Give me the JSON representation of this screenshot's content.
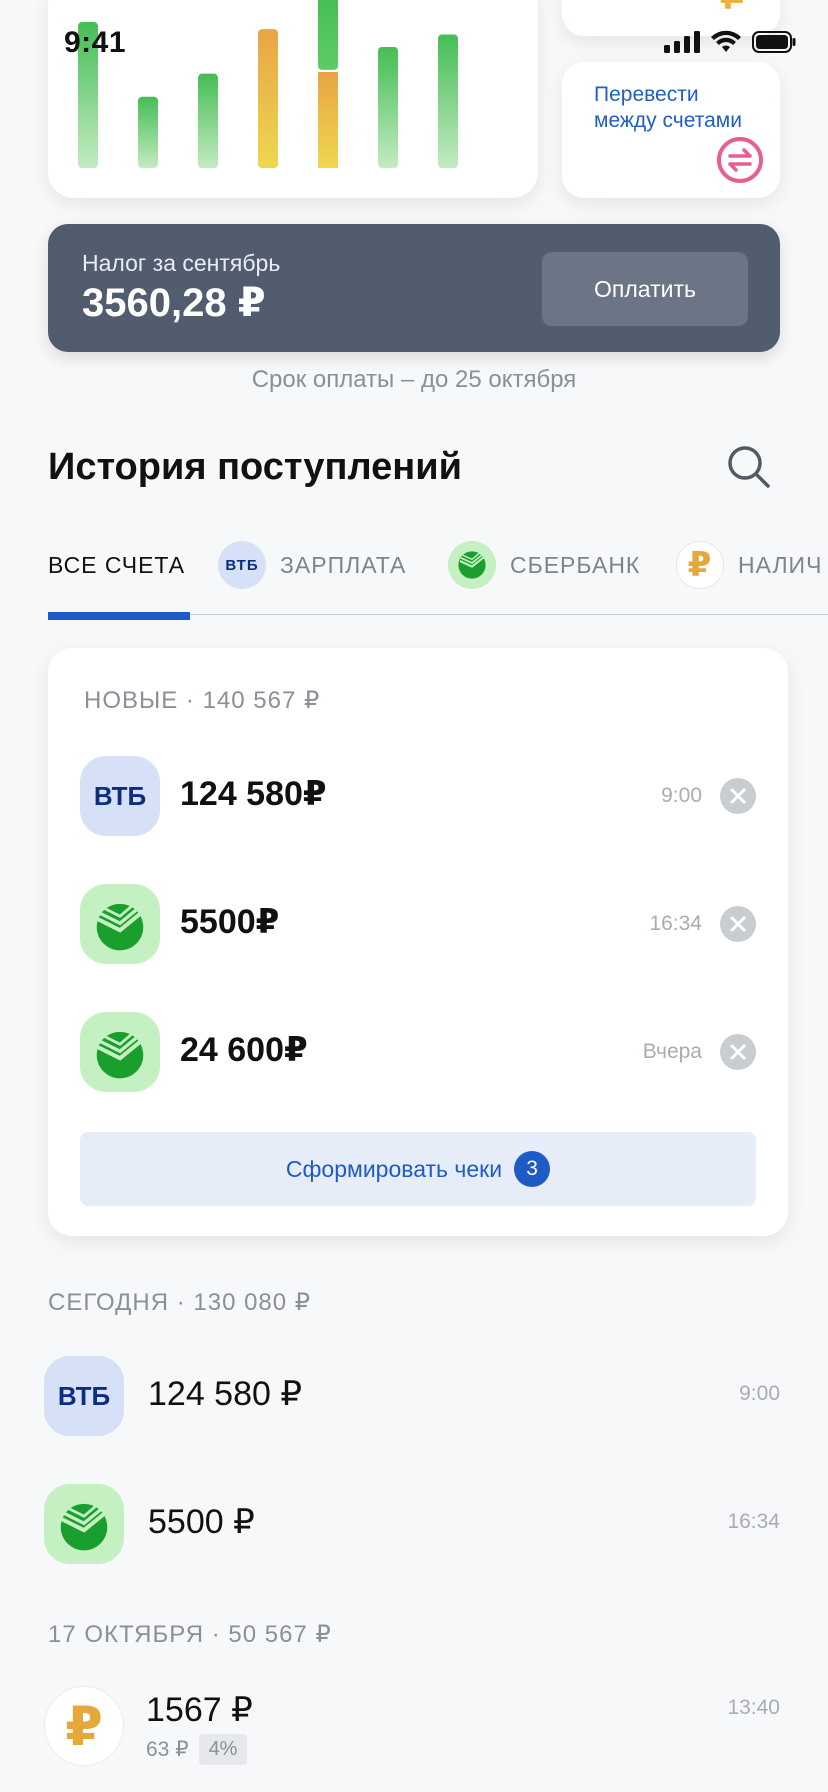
{
  "status_bar": {
    "time": "9:41"
  },
  "chart_card": {
    "bars": [
      {
        "total": 0.82,
        "split": null,
        "color": "green"
      },
      {
        "total": 0.4,
        "split": null,
        "color": "green"
      },
      {
        "total": 0.53,
        "split": null,
        "color": "green"
      },
      {
        "total": 0.78,
        "split": null,
        "color": "orange"
      },
      {
        "total": 1.0,
        "split": 0.54,
        "color": "mixed"
      },
      {
        "total": 0.68,
        "split": null,
        "color": "green"
      },
      {
        "total": 0.75,
        "split": null,
        "color": "green"
      }
    ]
  },
  "transfer_card": {
    "label": "Перевести между счетами"
  },
  "tax_card": {
    "label": "Налог за сентябрь",
    "amount": "3560,28 ₽",
    "pay_label": "Оплатить",
    "due_note": "Срок оплаты – до 25 октября"
  },
  "history": {
    "title": "История поступлений",
    "tabs": [
      {
        "label": "ВСЕ СЧЕТА",
        "badge": ""
      },
      {
        "label": "ЗАРПЛАТА",
        "badge": "ВТБ"
      },
      {
        "label": "СБЕРБАНК",
        "badge": ""
      },
      {
        "label": "НАЛИЧ",
        "badge": "₽"
      }
    ]
  },
  "new_group": {
    "header": "НОВЫЕ · 140 567 ₽",
    "rows": [
      {
        "bank": "ВТБ",
        "amount": "124 580₽",
        "time": "9:00"
      },
      {
        "bank": "",
        "amount": "5500₽",
        "time": "16:34"
      },
      {
        "bank": "",
        "amount": "24 600₽",
        "time": "Вчера"
      }
    ],
    "button_label": "Сформировать чеки",
    "button_count": "3"
  },
  "today_group": {
    "header": "СЕГОДНЯ · 130 080 ₽",
    "rows": [
      {
        "bank": "ВТБ",
        "amount": "124 580 ₽",
        "time": "9:00"
      },
      {
        "bank": "",
        "amount": "5500 ₽",
        "time": "16:34"
      }
    ]
  },
  "oct17_group": {
    "header": "17 ОКТЯБРЯ · 50 567 ₽",
    "rows": [
      {
        "bank": "₽",
        "amount": "1567 ₽",
        "time": "13:40",
        "sub_amount": "63 ₽",
        "sub_percent": "4%"
      }
    ]
  },
  "colors": {
    "accent": "#1e5bc6",
    "tax_card_bg": "#515c6e",
    "bar_green": "#4cc15a",
    "bar_orange": "#e7a846",
    "bar_yellow": "#efd24f",
    "transfer_icon": "#e85d92"
  }
}
